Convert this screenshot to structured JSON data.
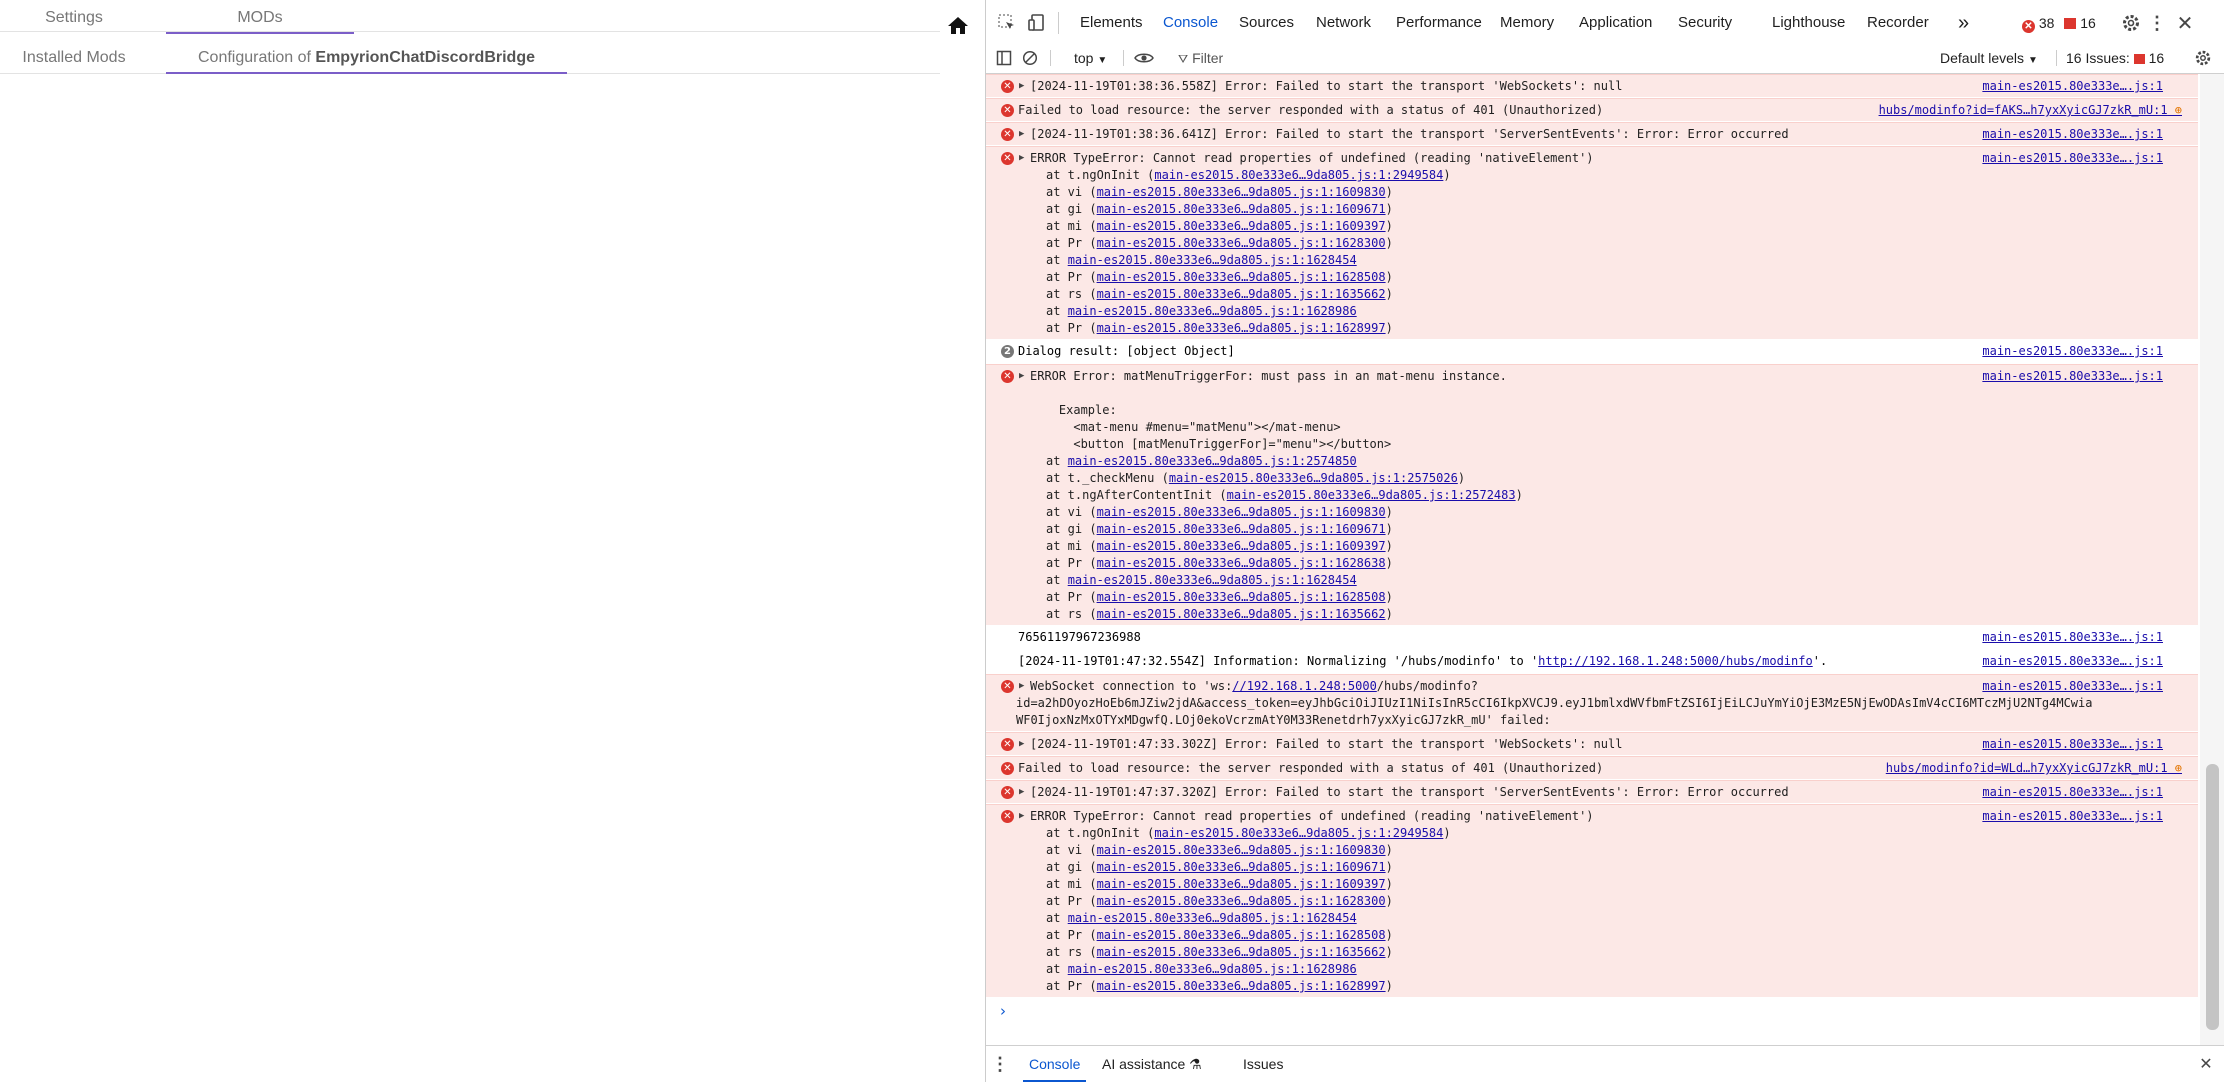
{
  "app": {
    "tabs": [
      {
        "label": "Settings"
      },
      {
        "label": "MODs"
      }
    ],
    "subtabs": [
      {
        "label": "Installed Mods"
      },
      {
        "label": "Configuration of ",
        "bold": "EmpyrionChatDiscordBridge"
      }
    ],
    "home_icon": "home-icon"
  },
  "devtools": {
    "toolbar_tabs": [
      "Elements",
      "Console",
      "Sources",
      "Network",
      "Performance",
      "Memory",
      "Application",
      "Security",
      "Lighthouse",
      "Recorder"
    ],
    "more_tabs": "»",
    "error_count": "38",
    "issue_count_top": "16",
    "console_bar": {
      "context": "top",
      "filter_placeholder": "Filter",
      "levels": "Default levels",
      "issues": "16 Issues:",
      "issues_count": "16"
    },
    "prompt": "›",
    "drawer": {
      "tabs": [
        "Console",
        "AI assistance",
        "Issues"
      ]
    }
  },
  "console": {
    "src": "main-es2015.80e333e….js:1",
    "msgs": [
      {
        "t": "err",
        "tri": true,
        "lines": [
          "[2024-11-19T01:38:36.558Z] Error: Failed to start the transport 'WebSockets': null"
        ]
      },
      {
        "t": "err",
        "tri": false,
        "lines": [
          "Failed to load resource: the server responded with a status of 401 (Unauthorized)"
        ],
        "src2": "hubs/modinfo?id=fAKS…h7yxXyicGJ7zkR_mU:1"
      },
      {
        "t": "err",
        "tri": true,
        "lines": [
          "[2024-11-19T01:38:36.641Z] Error: Failed to start the transport 'ServerSentEvents': Error: Error occurred"
        ]
      },
      {
        "t": "err",
        "tri": true,
        "lines": [
          "ERROR TypeError: Cannot read properties of undefined (reading 'nativeElement')"
        ],
        "stack": [
          [
            "t.ngOnInit (",
            "main-es2015.80e333e6…9da805.js:1:2949584",
            ")"
          ],
          [
            "vi (",
            "main-es2015.80e333e6…9da805.js:1:1609830",
            ")"
          ],
          [
            "gi (",
            "main-es2015.80e333e6…9da805.js:1:1609671",
            ")"
          ],
          [
            "mi (",
            "main-es2015.80e333e6…9da805.js:1:1609397",
            ")"
          ],
          [
            "Pr (",
            "main-es2015.80e333e6…9da805.js:1:1628300",
            ")"
          ],
          [
            "",
            "main-es2015.80e333e6…9da805.js:1:1628454",
            ""
          ],
          [
            "Pr (",
            "main-es2015.80e333e6…9da805.js:1:1628508",
            ")"
          ],
          [
            "rs (",
            "main-es2015.80e333e6…9da805.js:1:1635662",
            ")"
          ],
          [
            "",
            "main-es2015.80e333e6…9da805.js:1:1628986",
            ""
          ],
          [
            "Pr (",
            "main-es2015.80e333e6…9da805.js:1:1628997",
            ")"
          ]
        ]
      },
      {
        "t": "plain",
        "badge": "2",
        "lines": [
          "Dialog result: [object Object]"
        ]
      },
      {
        "t": "err",
        "tri": true,
        "lines": [
          "ERROR Error: matMenuTriggerFor: must pass in an mat-menu instance.",
          "",
          "    Example:",
          "      <mat-menu #menu=\"matMenu\"></mat-menu>",
          "      <button [matMenuTriggerFor]=\"menu\"></button>"
        ],
        "stack": [
          [
            "",
            "main-es2015.80e333e6…9da805.js:1:2574850",
            ""
          ],
          [
            "t._checkMenu (",
            "main-es2015.80e333e6…9da805.js:1:2575026",
            ")"
          ],
          [
            "t.ngAfterContentInit (",
            "main-es2015.80e333e6…9da805.js:1:2572483",
            ")"
          ],
          [
            "vi (",
            "main-es2015.80e333e6…9da805.js:1:1609830",
            ")"
          ],
          [
            "gi (",
            "main-es2015.80e333e6…9da805.js:1:1609671",
            ")"
          ],
          [
            "mi (",
            "main-es2015.80e333e6…9da805.js:1:1609397",
            ")"
          ],
          [
            "Pr (",
            "main-es2015.80e333e6…9da805.js:1:1628638",
            ")"
          ],
          [
            "",
            "main-es2015.80e333e6…9da805.js:1:1628454",
            ""
          ],
          [
            "Pr (",
            "main-es2015.80e333e6…9da805.js:1:1628508",
            ")"
          ],
          [
            "rs (",
            "main-es2015.80e333e6…9da805.js:1:1635662",
            ")"
          ]
        ]
      },
      {
        "t": "plain",
        "lines": [
          "76561197967236988"
        ]
      },
      {
        "t": "plain",
        "lines": [
          "[2024-11-19T01:47:32.554Z] Information: Normalizing '/hubs/modinfo' to '"
        ],
        "link": "http://192.168.1.248:5000/hubs/modinfo",
        "tail": "'."
      },
      {
        "t": "err",
        "tri": true,
        "ws": true,
        "lines": [
          "WebSocket connection to 'ws:",
          "id=a2hDOyozHoEb6mJZiw2jdA&access_token=eyJhbGciOiJIUzI1NiIsInR5cCI6IkpXVCJ9.eyJ1bmlxdWVfbmFtZSI6IjEiLCJuYmYiOjE3MzE5NjEwODAsImV4cCI6MTczMjU2NTg4MCwia",
          "WF0IjoxNzMxOTYxMDgwfQ.LOj0ekoVcrzmAtY0M33Renetdrh7yxXyicGJ7zkR_mU' failed:"
        ],
        "wslink": "//192.168.1.248:5000",
        "wstail": "/hubs/modinfo?"
      },
      {
        "t": "err",
        "tri": true,
        "lines": [
          "[2024-11-19T01:47:33.302Z] Error: Failed to start the transport 'WebSockets': null"
        ]
      },
      {
        "t": "err",
        "tri": false,
        "lines": [
          "Failed to load resource: the server responded with a status of 401 (Unauthorized)"
        ],
        "src2": "hubs/modinfo?id=WLd…h7yxXyicGJ7zkR_mU:1"
      },
      {
        "t": "err",
        "tri": true,
        "lines": [
          "[2024-11-19T01:47:37.320Z] Error: Failed to start the transport 'ServerSentEvents': Error: Error occurred"
        ]
      },
      {
        "t": "err",
        "tri": true,
        "lines": [
          "ERROR TypeError: Cannot read properties of undefined (reading 'nativeElement')"
        ],
        "stack": [
          [
            "t.ngOnInit (",
            "main-es2015.80e333e6…9da805.js:1:2949584",
            ")"
          ],
          [
            "vi (",
            "main-es2015.80e333e6…9da805.js:1:1609830",
            ")"
          ],
          [
            "gi (",
            "main-es2015.80e333e6…9da805.js:1:1609671",
            ")"
          ],
          [
            "mi (",
            "main-es2015.80e333e6…9da805.js:1:1609397",
            ")"
          ],
          [
            "Pr (",
            "main-es2015.80e333e6…9da805.js:1:1628300",
            ")"
          ],
          [
            "",
            "main-es2015.80e333e6…9da805.js:1:1628454",
            ""
          ],
          [
            "Pr (",
            "main-es2015.80e333e6…9da805.js:1:1628508",
            ")"
          ],
          [
            "rs (",
            "main-es2015.80e333e6…9da805.js:1:1635662",
            ")"
          ],
          [
            "",
            "main-es2015.80e333e6…9da805.js:1:1628986",
            ""
          ],
          [
            "Pr (",
            "main-es2015.80e333e6…9da805.js:1:1628997",
            ")"
          ]
        ]
      }
    ]
  }
}
